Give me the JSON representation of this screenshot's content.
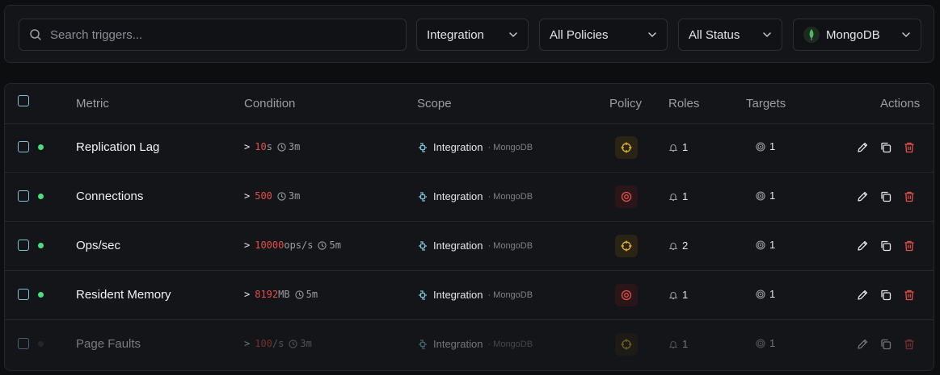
{
  "filters": {
    "search_placeholder": "Search triggers...",
    "integration": "Integration",
    "policies": "All Policies",
    "status": "All Status",
    "database": "MongoDB"
  },
  "table": {
    "headers": {
      "metric": "Metric",
      "condition": "Condition",
      "scope": "Scope",
      "policy": "Policy",
      "roles": "Roles",
      "targets": "Targets",
      "actions": "Actions"
    },
    "rows": [
      {
        "metric": "Replication Lag",
        "op": ">",
        "value": "10",
        "unit": "s",
        "duration": "3m",
        "scope": "Integration",
        "scope_sub": "· MongoDB",
        "policy": "warning",
        "roles": "1",
        "targets": "1",
        "active": true
      },
      {
        "metric": "Connections",
        "op": ">",
        "value": "500",
        "unit": "",
        "duration": "3m",
        "scope": "Integration",
        "scope_sub": "· MongoDB",
        "policy": "critical",
        "roles": "1",
        "targets": "1",
        "active": true
      },
      {
        "metric": "Ops/sec",
        "op": ">",
        "value": "10000",
        "unit": "ops/s",
        "duration": "5m",
        "scope": "Integration",
        "scope_sub": "· MongoDB",
        "policy": "warning",
        "roles": "2",
        "targets": "1",
        "active": true
      },
      {
        "metric": "Resident Memory",
        "op": ">",
        "value": "8192",
        "unit": "MB",
        "duration": "5m",
        "scope": "Integration",
        "scope_sub": "· MongoDB",
        "policy": "critical",
        "roles": "1",
        "targets": "1",
        "active": true
      },
      {
        "metric": "Page Faults",
        "op": ">",
        "value": "100",
        "unit": "/s",
        "duration": "3m",
        "scope": "Integration",
        "scope_sub": "· MongoDB",
        "policy": "warning",
        "roles": "1",
        "targets": "1",
        "active": false
      }
    ]
  },
  "colors": {
    "accent_checkbox": "#7fc3d9",
    "status_active": "#4ade80",
    "status_inactive": "#3a3c40",
    "value_red": "#e2504a",
    "warning": "#e8b33a",
    "critical": "#e2504a",
    "delete": "#e2504a"
  }
}
